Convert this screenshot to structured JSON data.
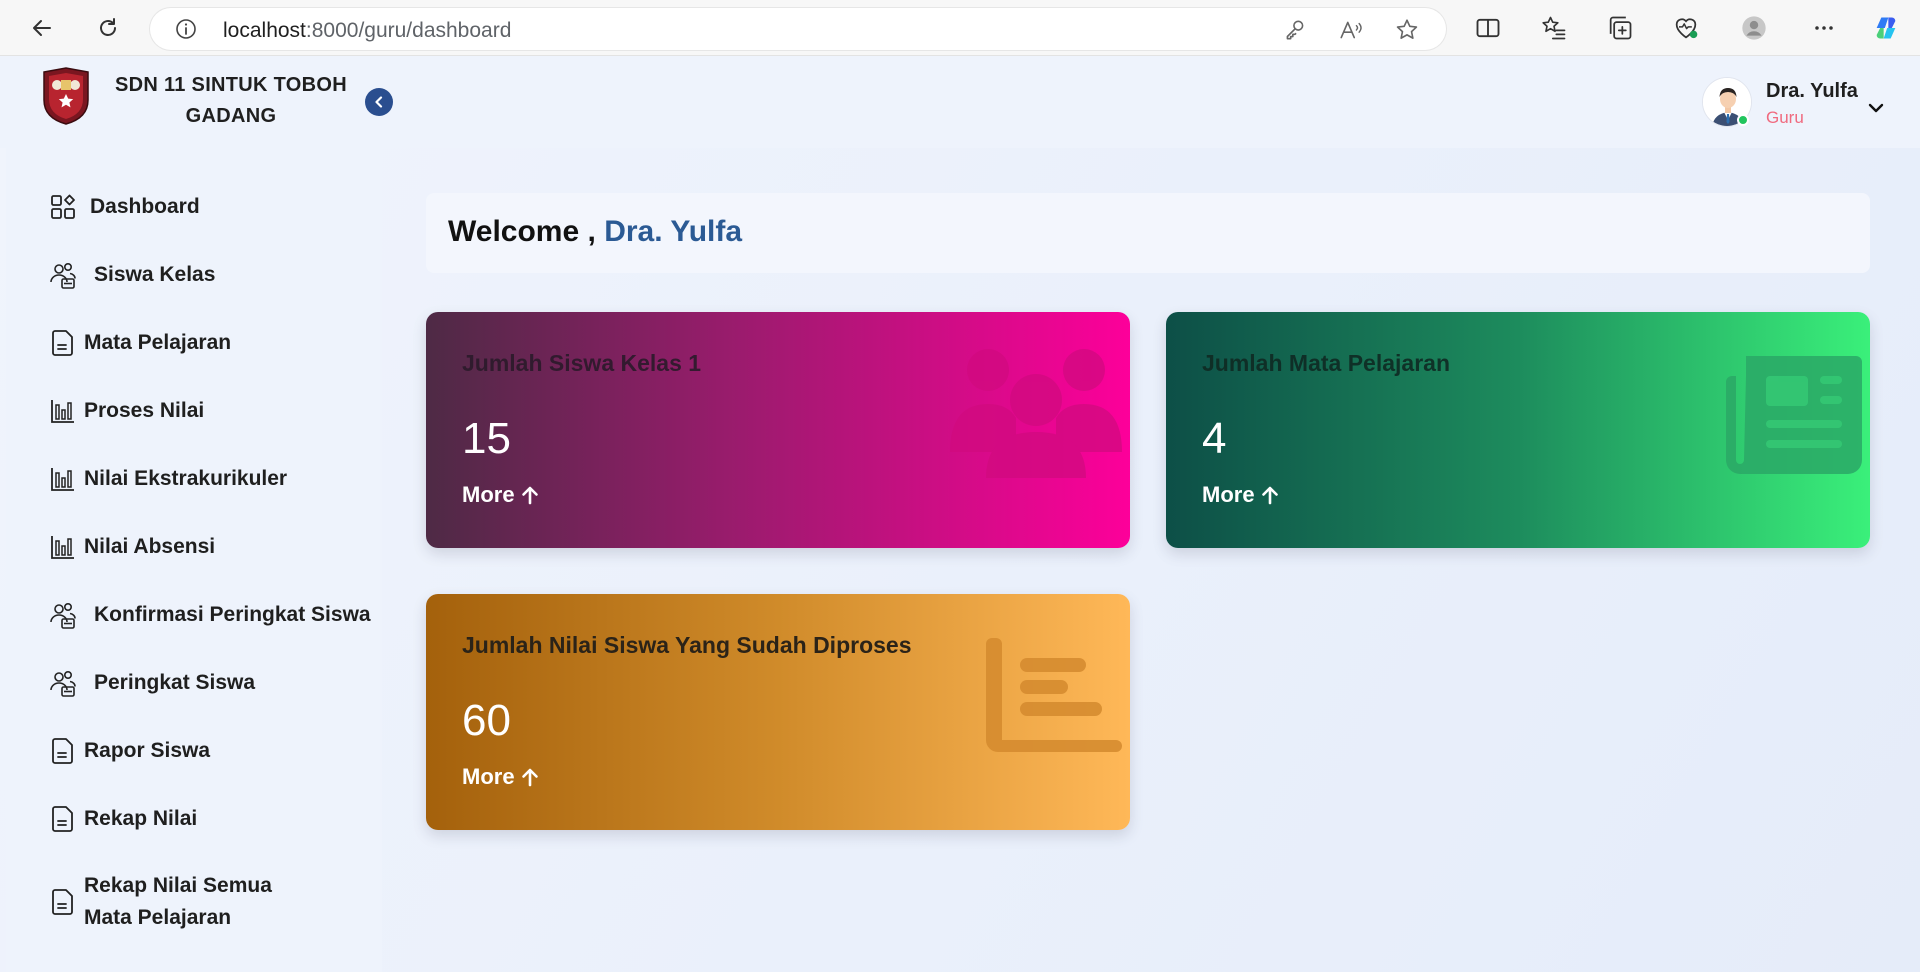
{
  "browser": {
    "url_host": "localhost",
    "url_path": ":8000/guru/dashboard"
  },
  "header": {
    "school_line1": "SDN 11 SINTUK TOBOH",
    "school_line2": "GADANG",
    "user_name": "Dra. Yulfa",
    "user_role": "Guru"
  },
  "sidebar": {
    "items": [
      {
        "label": "Dashboard",
        "icon": "dashboard-icon"
      },
      {
        "label": "Siswa Kelas",
        "icon": "users-icon"
      },
      {
        "label": "Mata Pelajaran",
        "icon": "document-icon"
      },
      {
        "label": "Proses Nilai",
        "icon": "bar-chart-icon"
      },
      {
        "label": "Nilai Ekstrakurikuler",
        "icon": "bar-chart-icon"
      },
      {
        "label": "Nilai Absensi",
        "icon": "bar-chart-icon"
      },
      {
        "label": "Konfirmasi Peringkat Siswa",
        "icon": "users-icon"
      },
      {
        "label": "Peringkat Siswa",
        "icon": "users-icon"
      },
      {
        "label": "Rapor Siswa",
        "icon": "document-icon"
      },
      {
        "label": "Rekap Nilai",
        "icon": "document-icon"
      },
      {
        "label_line1": "Rekap Nilai Semua",
        "label_line2": "Mata Pelajaran",
        "icon": "document-icon"
      }
    ]
  },
  "main": {
    "welcome_prefix": "Welcome ,",
    "welcome_name": "Dra. Yulfa",
    "cards": [
      {
        "title": "Jumlah Siswa Kelas 1",
        "value": "15",
        "more": "More",
        "icon": "users-icon",
        "gradient": [
          "#4e2a45",
          "#fd009a"
        ]
      },
      {
        "title": "Jumlah Mata Pelajaran",
        "value": "4",
        "more": "More",
        "icon": "newspaper-icon",
        "gradient": [
          "#0d4f47",
          "#3af07a"
        ]
      },
      {
        "title": "Jumlah Nilai Siswa Yang Sudah Diproses",
        "value": "60",
        "more": "More",
        "icon": "list-chart-icon",
        "gradient": [
          "#a4610c",
          "#ffb858"
        ]
      }
    ]
  },
  "colors": {
    "accent": "#2b5a94",
    "role": "#f06a7f",
    "online": "#22c55e"
  }
}
